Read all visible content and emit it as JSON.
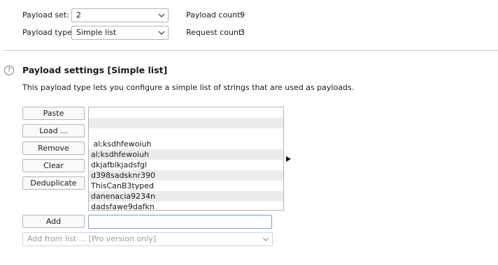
{
  "payload_sets": {
    "set_label": "Payload set:",
    "set_value": "2",
    "type_label": "Payload type:",
    "type_value": "Simple list",
    "count_label": "Payload count:",
    "count_value": "9",
    "request_label": "Request count:",
    "request_value": "3"
  },
  "settings": {
    "title": "Payload settings [Simple list]",
    "description": "This payload type lets you configure a simple list of strings that are used as payloads.",
    "buttons": {
      "paste": "Paste",
      "load": "Load ...",
      "remove": "Remove",
      "clear": "Clear",
      "deduplicate": "Deduplicate",
      "add": "Add"
    },
    "list_items": [
      "",
      "",
      "",
      " al;ksdhfewoiuh",
      "al;ksdhfewoiuh",
      "dkjafblkjadsfgl",
      "d398sadsknr390",
      "ThisCanB3typed",
      "danenacia9234n",
      "dadsfawe9dafkn"
    ],
    "add_input_value": "",
    "add_from_list": "Add from list ... [Pro version only]"
  },
  "icons": {
    "help": "help-circle-icon",
    "dropdown": "chevron-down-icon",
    "arrow": "triangle-right-icon"
  }
}
